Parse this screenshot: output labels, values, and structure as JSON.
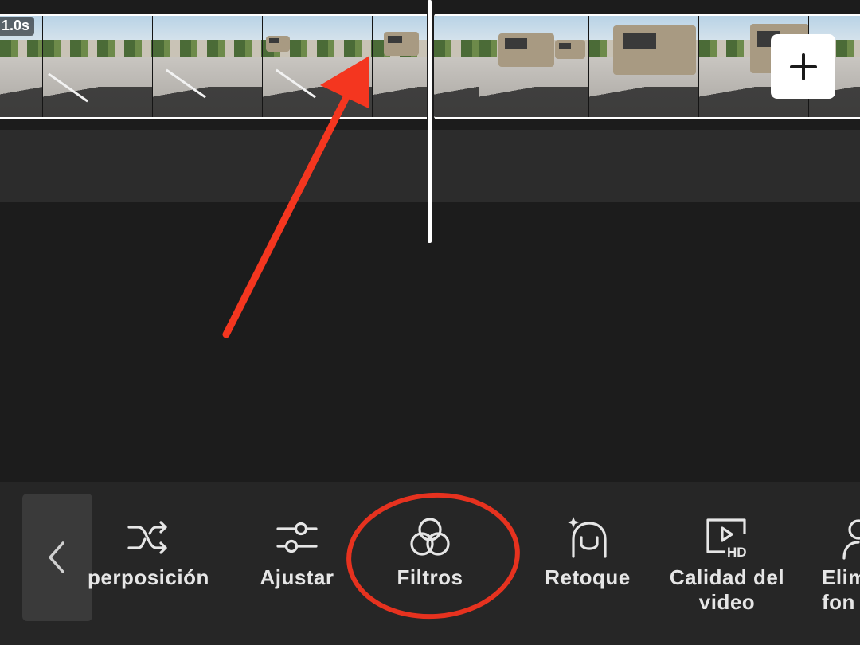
{
  "timeline": {
    "clip_duration": "1.0s",
    "add_clip_icon": "plus-icon"
  },
  "toolbar": {
    "back_icon": "chevron-left-icon",
    "tools": [
      {
        "label": "perposición",
        "icon": "shuffle-icon"
      },
      {
        "label": "Ajustar",
        "icon": "sliders-icon"
      },
      {
        "label": "Filtros",
        "icon": "filter-circles-icon"
      },
      {
        "label": "Retoque",
        "icon": "face-retouch-icon"
      },
      {
        "label": "Calidad del video",
        "icon": "hd-video-icon"
      },
      {
        "label": "Elim fon",
        "icon": "person-remove-bg-icon"
      }
    ]
  },
  "colors": {
    "accent_arrow": "#f4361f",
    "highlight_circle": "#e6321f",
    "toolbar_bg": "#262626",
    "app_bg": "#1c1c1c"
  }
}
